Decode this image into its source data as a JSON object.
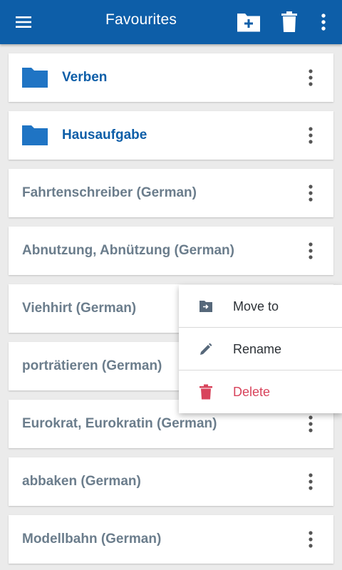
{
  "appbar": {
    "title": "Favourites",
    "color": "#0d5ea8",
    "icons": [
      "hamburger-menu-icon",
      "new-folder-icon",
      "trash-icon",
      "overflow-menu-icon"
    ]
  },
  "list": {
    "items": [
      {
        "label": "Verben",
        "type": "folder"
      },
      {
        "label": "Hausaufgabe",
        "type": "folder"
      },
      {
        "label": "Fahrtenschreiber (German)",
        "type": "word"
      },
      {
        "label": "Abnutzung, Abnützung (German)",
        "type": "word"
      },
      {
        "label": "Viehhirt (German)",
        "type": "word"
      },
      {
        "label": "porträtieren (German)",
        "type": "word"
      },
      {
        "label": "Eurokrat, Eurokratin (German)",
        "type": "word"
      },
      {
        "label": "abbaken (German)",
        "type": "word"
      },
      {
        "label": "Modellbahn (German)",
        "type": "word"
      }
    ]
  },
  "context_menu": {
    "move_to": "Move to",
    "rename": "Rename",
    "delete": "Delete",
    "delete_color": "#d8445c"
  }
}
